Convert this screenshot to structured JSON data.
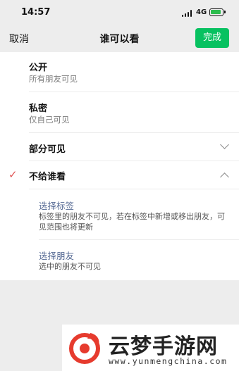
{
  "status_bar": {
    "time": "14:57",
    "network": "4G"
  },
  "nav": {
    "cancel_label": "取消",
    "title": "谁可以看",
    "done_label": "完成",
    "done_color": "#07c160"
  },
  "options": [
    {
      "title": "公开",
      "description": "所有朋友可见"
    },
    {
      "title": "私密",
      "description": "仅自己可见"
    },
    {
      "title": "部分可见",
      "expand_icon": "chevron-down-icon"
    },
    {
      "title": "不给谁看",
      "selected": true,
      "expand_icon": "chevron-up-icon"
    }
  ],
  "sub_options": [
    {
      "title": "选择标签",
      "description": "标签里的朋友不可见，若在标签中新增或移出朋友，可见范围也将更新"
    },
    {
      "title": "选择朋友",
      "description": "选中的朋友不可见"
    }
  ],
  "check_icon": "✓",
  "colors": {
    "check": "#e05555",
    "link": "#576b95"
  },
  "watermark": {
    "name": "云梦手游网",
    "url": "www.yunmengchina.com"
  }
}
